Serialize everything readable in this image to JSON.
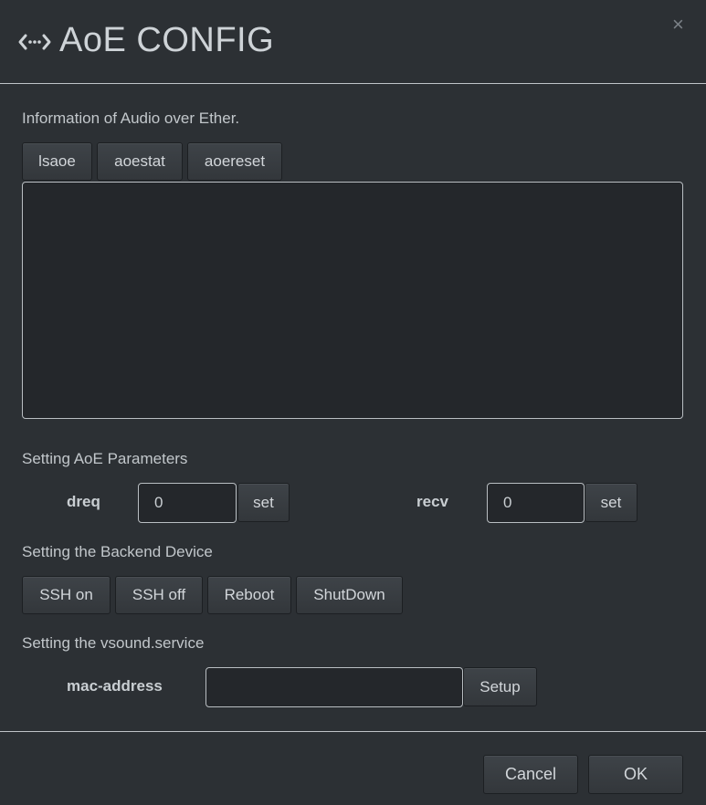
{
  "dialog": {
    "title": "AoE CONFIG",
    "title_icon": "code-arrows-icon",
    "close_label": "×"
  },
  "info": {
    "label": "Information of Audio over Ether.",
    "buttons": [
      "lsaoe",
      "aoestat",
      "aoereset"
    ],
    "output_text": ""
  },
  "params": {
    "label": "Setting AoE Parameters",
    "dreq": {
      "label": "dreq",
      "value": "0",
      "set_label": "set"
    },
    "recv": {
      "label": "recv",
      "value": "0",
      "set_label": "set"
    }
  },
  "backend": {
    "label": "Setting the Backend Device",
    "buttons": [
      "SSH on",
      "SSH off",
      "Reboot",
      "ShutDown"
    ]
  },
  "vsound": {
    "label": "Setting the vsound.service",
    "mac_label": "mac-address",
    "mac_value": "",
    "setup_label": "Setup"
  },
  "footer": {
    "cancel_label": "Cancel",
    "ok_label": "OK"
  }
}
